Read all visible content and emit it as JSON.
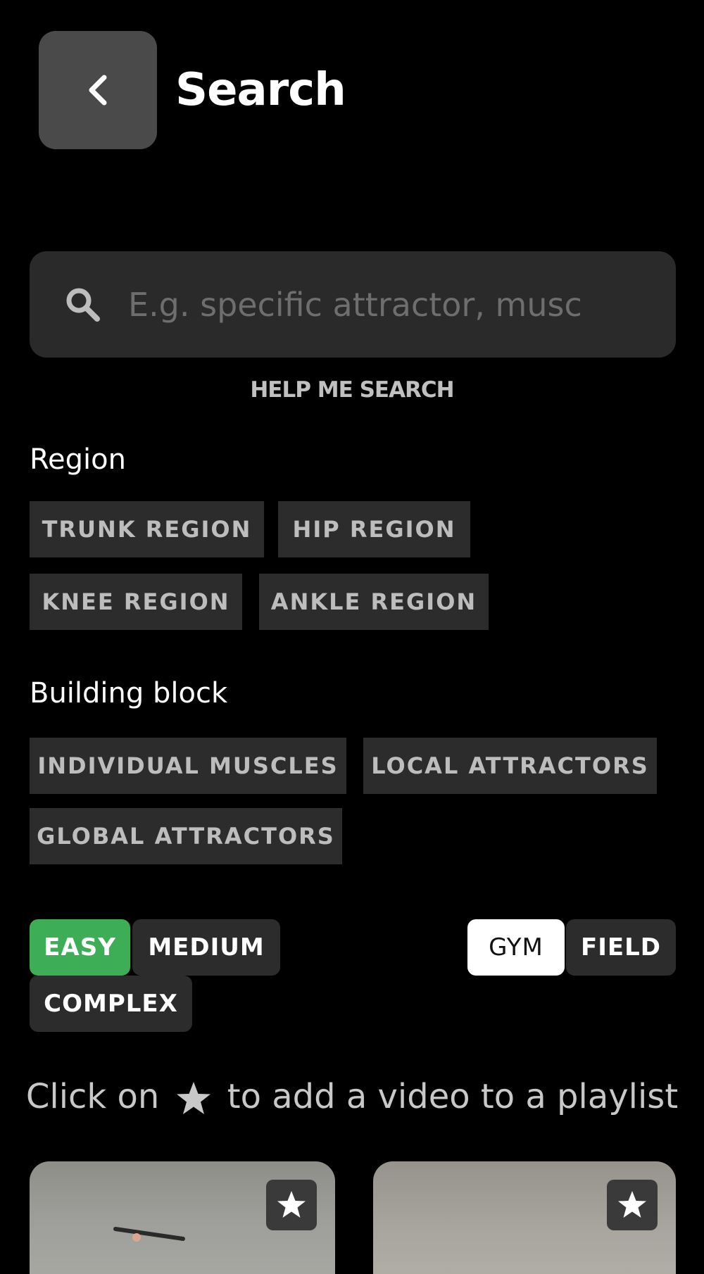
{
  "header": {
    "back_icon": "chevron-left-icon",
    "title": "Search"
  },
  "search": {
    "icon": "search-icon",
    "placeholder": "E.g. specific attractor, musc",
    "value": ""
  },
  "help_link": "HELP ME SEARCH",
  "region": {
    "heading": "Region",
    "chips": [
      "TRUNK REGION",
      "HIP REGION",
      "KNEE REGION",
      "ANKLE REGION"
    ]
  },
  "building_block": {
    "heading": "Building block",
    "chips": [
      "INDIVIDUAL MUSCLES",
      "LOCAL ATTRACTORS",
      "GLOBAL ATTRACTORS"
    ]
  },
  "difficulty": {
    "options": [
      "EASY",
      "MEDIUM",
      "COMPLEX"
    ],
    "selected": "EASY"
  },
  "location": {
    "options": [
      "GYM",
      "FIELD"
    ],
    "selected": "GYM"
  },
  "hint": {
    "before": "Click on",
    "icon": "star-icon",
    "after": "to add a video to a playlist"
  },
  "videos": [
    {
      "favorite_icon": "star-icon"
    },
    {
      "favorite_icon": "star-icon"
    }
  ],
  "colors": {
    "background": "#000000",
    "chip_bg": "#2c2c2c",
    "easy_active": "#3dae56",
    "gym_active": "#ffffff"
  }
}
